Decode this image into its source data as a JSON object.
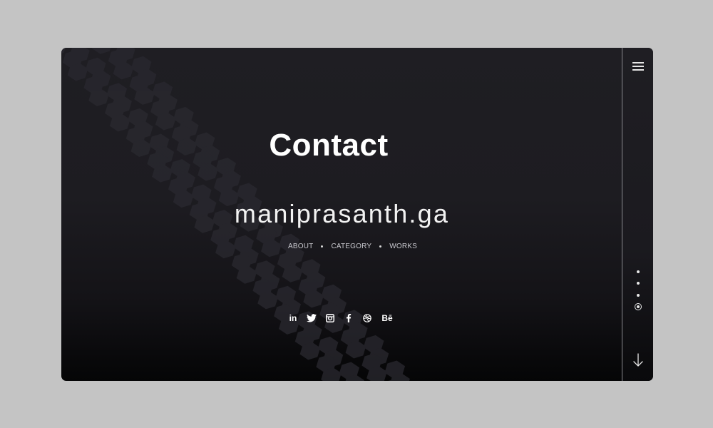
{
  "page": {
    "title": "Contact",
    "domain": "maniprasanth.ga"
  },
  "nav": {
    "items": [
      {
        "label": "ABOUT"
      },
      {
        "label": "CATEGORY"
      },
      {
        "label": "WORKS"
      }
    ]
  },
  "social": {
    "icons": [
      "linkedin-icon",
      "twitter-icon",
      "instagram-icon",
      "facebook-icon",
      "dribbble-icon",
      "behance-icon"
    ],
    "linkedin_label": "in",
    "behance_label": "Bē"
  },
  "sidebar": {
    "menu_icon": "hamburger-menu-icon",
    "pager_count": 4,
    "active_page": 4,
    "down_icon": "arrow-down-icon"
  },
  "colors": {
    "background": "#c4c4c4",
    "panel": "#1d1c21",
    "text": "#ffffff",
    "muted": "#c9c9cf"
  }
}
